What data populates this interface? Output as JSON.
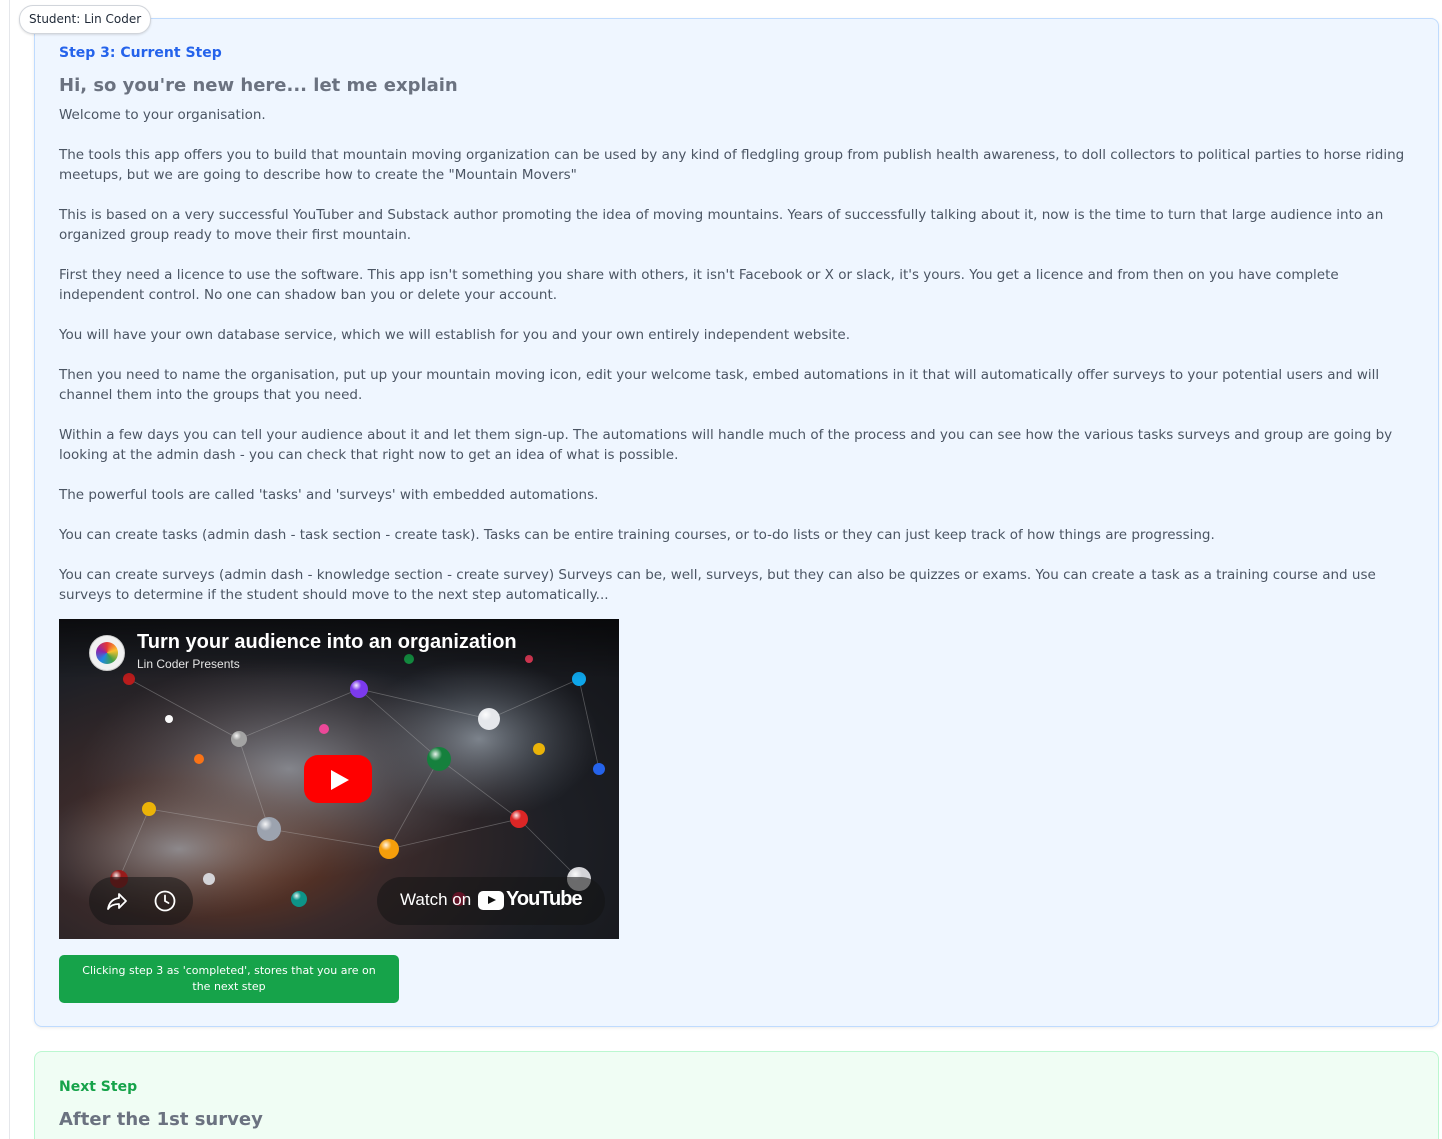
{
  "student_badge": "Student: Lin Coder",
  "current_step": {
    "label": "Step 3: Current Step",
    "title": "Hi, so you're new here... let me explain",
    "paragraphs": [
      "Welcome to your organisation.",
      "The tools this app offers you to build that mountain moving organization can be used by any kind of fledgling group from publish health awareness, to doll collectors to political parties to horse riding meetups, but we are going to describe how to create the \"Mountain Movers\"",
      "This is based on a very successful YouTuber and Substack author promoting the idea of moving mountains. Years of successfully talking about it, now is the time to turn that large audience into an organized group ready to move their first mountain.",
      "First they need a licence to use the software. This app isn't something you share with others, it isn't Facebook or X or slack, it's yours. You get a licence and from then on you have complete independent control. No one can shadow ban you or delete your account.",
      "You will have your own database service, which we will establish for you and your own entirely independent website.",
      "Then you need to name the organisation, put up your mountain moving icon, edit your welcome task, embed automations in it that will automatically offer surveys to your potential users and will channel them into the groups that you need.",
      "Within a few days you can tell your audience about it and let them sign-up. The automations will handle much of the process and you can see how the various tasks surveys and group are going by looking at the admin dash - you can check that right now to get an idea of what is possible.",
      "The powerful tools are called 'tasks' and 'surveys' with embedded automations.",
      "You can create tasks (admin dash - task section - create task). Tasks can be entire training courses, or to-do lists or they can just keep track of how things are progressing.",
      "You can create surveys (admin dash - knowledge section - create survey) Surveys can be, well, surveys, but they can also be quizzes or exams. You can create a task as a training course and use surveys to determine if the student should move to the next step automatically..."
    ],
    "video": {
      "title": "Turn your audience into an organization",
      "channel": "Lin Coder Presents",
      "watch_on": "Watch on",
      "youtube_word": "YouTube",
      "icons": [
        "play-icon",
        "share-icon",
        "watch-later-icon",
        "youtube-logo-icon"
      ]
    },
    "complete_button": "Clicking step 3 as 'completed', stores that you are on the next step"
  },
  "next_step": {
    "label": "Next Step",
    "title": "After the 1st survey"
  },
  "colors": {
    "current_bg": "#eff6ff",
    "current_border": "#bfdbfe",
    "step_blue": "#2563eb",
    "next_bg": "#f0fdf4",
    "next_green": "#16a34a",
    "button_green": "#16a34a"
  }
}
